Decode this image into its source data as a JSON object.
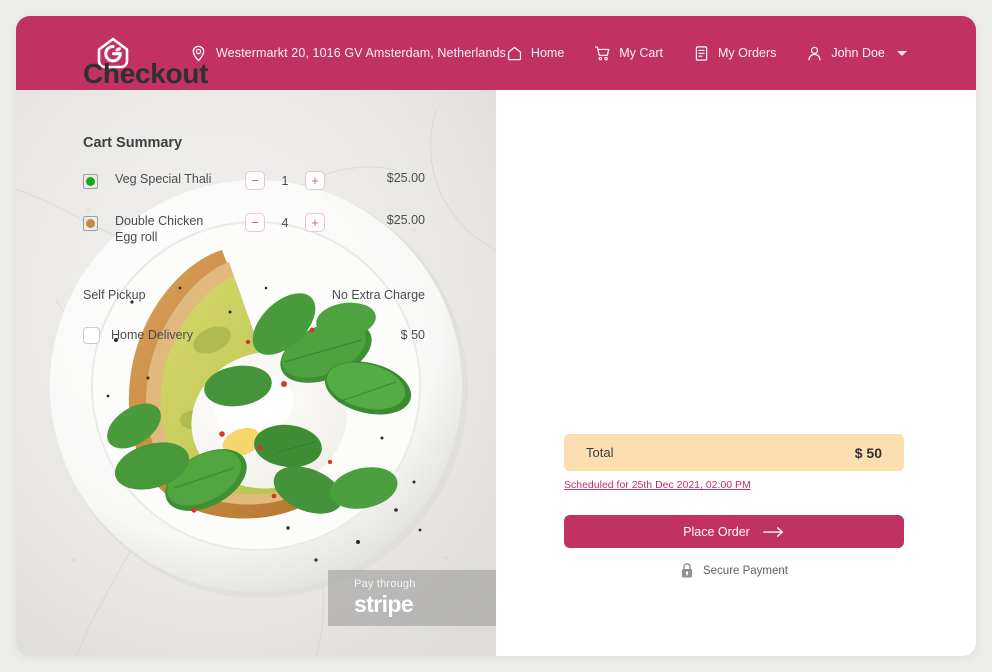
{
  "header": {
    "logo_icon": "house-spoon-logo-icon",
    "location_icon": "map-pin-icon",
    "location": "Westermarkt 20, 1016 GV Amsterdam, Netherlands",
    "nav": [
      {
        "label": "Home",
        "icon": "home-icon"
      },
      {
        "label": "My Cart",
        "icon": "shopping-cart-icon"
      },
      {
        "label": "My Orders",
        "icon": "document-list-icon"
      },
      {
        "label": "John Doe",
        "icon": "user-icon",
        "caret": "chevron-down-icon"
      }
    ],
    "bg_color": "#c13161"
  },
  "hero": {
    "photo_alt": "avocado-toast-poached-egg-plate",
    "stripe_badge": {
      "pay_through": "Pay through",
      "brand": "stripe"
    }
  },
  "checkout": {
    "title": "Checkout",
    "cart_summary_title": "Cart Summary",
    "items": [
      {
        "diet": "veg",
        "diet_color": "#1aa81a",
        "name": "Veg Special Thali",
        "decrement": "−",
        "quantity": "1",
        "increment": "+",
        "price": "$25.00"
      },
      {
        "diet": "nonveg",
        "diet_color": "#c2894a",
        "name": "Double Chicken Egg roll",
        "decrement": "−",
        "quantity": "4",
        "increment": "+",
        "price": "$25.00"
      }
    ],
    "delivery": [
      {
        "label": "Self Pickup",
        "amount": "No Extra Charge",
        "has_checkbox": false,
        "checked": false
      },
      {
        "label": "Home Delivery",
        "amount": "$ 50",
        "has_checkbox": true,
        "checked": false
      }
    ],
    "total": {
      "label": "Total",
      "amount": "$ 50",
      "bg_color": "#fbdfb0"
    },
    "scheduled_link": "Scheduled for 25th Dec 2021,  02:00 PM",
    "place_order": {
      "label": "Place Order",
      "icon": "arrow-right-icon",
      "bg_color": "#c13161"
    },
    "secure_payment": {
      "label": "Secure Payment",
      "icon": "lock-icon"
    }
  }
}
